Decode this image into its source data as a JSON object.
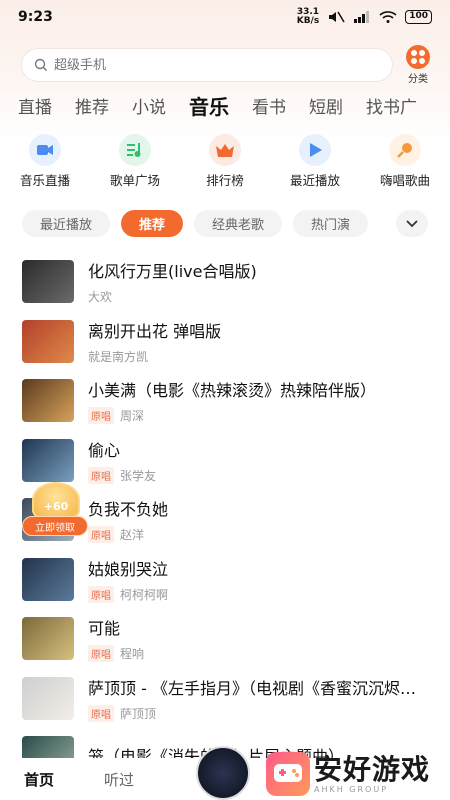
{
  "status_bar": {
    "time": "9:23",
    "net_speed_value": "33.1",
    "net_speed_unit": "KB/s",
    "battery": "100"
  },
  "search": {
    "placeholder": "超级手机",
    "category_label": "分类"
  },
  "top_tabs": [
    {
      "label": "直播",
      "active": false
    },
    {
      "label": "推荐",
      "active": false
    },
    {
      "label": "小说",
      "active": false
    },
    {
      "label": "音乐",
      "active": true
    },
    {
      "label": "看书",
      "active": false
    },
    {
      "label": "短剧",
      "active": false
    },
    {
      "label": "找书广",
      "active": false
    }
  ],
  "quick_entries": [
    {
      "label": "音乐直播",
      "icon": "music-live-icon",
      "color": "#4a8cf0"
    },
    {
      "label": "歌单广场",
      "icon": "playlist-icon",
      "color": "#2fbf71"
    },
    {
      "label": "排行榜",
      "icon": "crown-icon",
      "color": "#f26a2e"
    },
    {
      "label": "最近播放",
      "icon": "play-icon",
      "color": "#4a8cf0"
    },
    {
      "label": "嗨唱歌曲",
      "icon": "mic-icon",
      "color": "#f59a3a"
    }
  ],
  "chips": [
    {
      "label": "最近播放",
      "active": false
    },
    {
      "label": "推荐",
      "active": true
    },
    {
      "label": "经典老歌",
      "active": false
    },
    {
      "label": "热门演",
      "active": false
    }
  ],
  "songs": [
    {
      "title": "化风行万里(live合唱版)",
      "artist": "大欢",
      "original": false,
      "cover": [
        "#2a2a2a",
        "#6b6b6b"
      ]
    },
    {
      "title": "离别开出花 弹唱版",
      "artist": "就是南方凯",
      "original": false,
      "cover": [
        "#b2402a",
        "#e08a4a"
      ]
    },
    {
      "title": "小美满（电影《热辣滚烫》热辣陪伴版）",
      "artist": "周深",
      "original": true,
      "cover": [
        "#5a3a20",
        "#d9a35a"
      ]
    },
    {
      "title": "偷心",
      "artist": "张学友",
      "original": true,
      "cover": [
        "#1f3550",
        "#7aa0c0"
      ]
    },
    {
      "title": "负我不负她",
      "artist": "赵洋",
      "original": true,
      "cover": [
        "#3b4a5a",
        "#a0b0c0"
      ]
    },
    {
      "title": "姑娘别哭泣",
      "artist": "柯柯柯啊",
      "original": true,
      "cover": [
        "#23344a",
        "#5a7a9a"
      ]
    },
    {
      "title": "可能",
      "artist": "程响",
      "original": true,
      "cover": [
        "#7a6a3a",
        "#d9c080"
      ]
    },
    {
      "title": "萨顶顶 - 《左手指月》（电视剧《香蜜沉沉烬如霜》）",
      "artist": "萨顶顶",
      "original": true,
      "cover": [
        "#cfcfcf",
        "#f2eee8"
      ]
    },
    {
      "title": "笼（电影《消失的她》片尾主题曲）",
      "artist": "",
      "original": false,
      "cover": [
        "#2a4a4a",
        "#9ab0a0"
      ]
    }
  ],
  "original_tag": "原唱",
  "reward": {
    "amount": "+60",
    "button": "立即领取"
  },
  "bottom_nav": [
    {
      "label": "首页",
      "active": true
    },
    {
      "label": "听过",
      "active": false
    }
  ],
  "watermark": {
    "title": "安好游戏",
    "subtitle": "AHKH GROUP"
  }
}
